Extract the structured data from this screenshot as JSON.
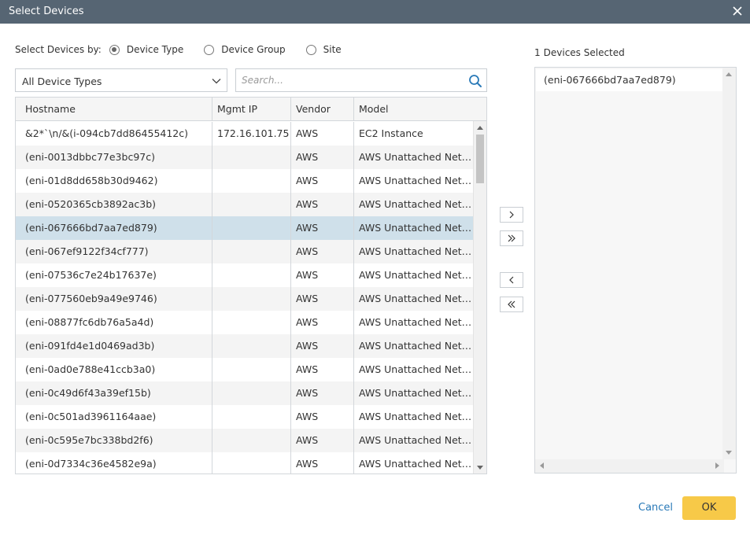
{
  "dialog": {
    "title": "Select Devices"
  },
  "filter": {
    "label": "Select Devices by:",
    "options": [
      {
        "label": "Device Type",
        "checked": true
      },
      {
        "label": "Device Group",
        "checked": false
      },
      {
        "label": "Site",
        "checked": false
      }
    ],
    "select_value": "All Device Types",
    "search_placeholder": "Search..."
  },
  "table": {
    "columns": [
      "Hostname",
      "Mgmt IP",
      "Vendor",
      "Model"
    ],
    "rows": [
      {
        "hostname": "&2*`\\n/&(i-094cb7dd86455412c)",
        "ip": "172.16.101.75",
        "vendor": "AWS",
        "model": "EC2 Instance"
      },
      {
        "hostname": "(eni-0013dbbc77e3bc97c)",
        "ip": "",
        "vendor": "AWS",
        "model": "AWS Unattached Netw..."
      },
      {
        "hostname": "(eni-01d8dd658b30d9462)",
        "ip": "",
        "vendor": "AWS",
        "model": "AWS Unattached Netw..."
      },
      {
        "hostname": "(eni-0520365cb3892ac3b)",
        "ip": "",
        "vendor": "AWS",
        "model": "AWS Unattached Netw..."
      },
      {
        "hostname": "(eni-067666bd7aa7ed879)",
        "ip": "",
        "vendor": "AWS",
        "model": "AWS Unattached Netw...",
        "selected": true
      },
      {
        "hostname": "(eni-067ef9122f34cf777)",
        "ip": "",
        "vendor": "AWS",
        "model": "AWS Unattached Netw..."
      },
      {
        "hostname": "(eni-07536c7e24b17637e)",
        "ip": "",
        "vendor": "AWS",
        "model": "AWS Unattached Netw..."
      },
      {
        "hostname": "(eni-077560eb9a49e9746)",
        "ip": "",
        "vendor": "AWS",
        "model": "AWS Unattached Netw..."
      },
      {
        "hostname": "(eni-08877fc6db76a5a4d)",
        "ip": "",
        "vendor": "AWS",
        "model": "AWS Unattached Netw..."
      },
      {
        "hostname": "(eni-091fd4e1d0469ad3b)",
        "ip": "",
        "vendor": "AWS",
        "model": "AWS Unattached Netw..."
      },
      {
        "hostname": "(eni-0ad0e788e41ccb3a0)",
        "ip": "",
        "vendor": "AWS",
        "model": "AWS Unattached Netw..."
      },
      {
        "hostname": "(eni-0c49d6f43a39ef15b)",
        "ip": "",
        "vendor": "AWS",
        "model": "AWS Unattached Netw..."
      },
      {
        "hostname": "(eni-0c501ad3961164aae)",
        "ip": "",
        "vendor": "AWS",
        "model": "AWS Unattached Netw..."
      },
      {
        "hostname": "(eni-0c595e7bc338bd2f6)",
        "ip": "",
        "vendor": "AWS",
        "model": "AWS Unattached Netw..."
      },
      {
        "hostname": "(eni-0d7334c36e4582e9a)",
        "ip": "",
        "vendor": "AWS",
        "model": "AWS Unattached Netw..."
      }
    ]
  },
  "selected_panel": {
    "count": "1",
    "label": "Devices Selected",
    "items": [
      "(eni-067666bd7aa7ed879)"
    ]
  },
  "transfer_buttons": [
    {
      "name": "move-selected-right",
      "icon": "chevron-right-icon"
    },
    {
      "name": "move-all-right",
      "icon": "double-chevron-right-icon"
    },
    {
      "name": "move-selected-left",
      "icon": "chevron-left-icon"
    },
    {
      "name": "move-all-left",
      "icon": "double-chevron-left-icon"
    }
  ],
  "footer": {
    "cancel_label": "Cancel",
    "ok_label": "OK"
  },
  "colors": {
    "titlebar": "#566573",
    "selected_row": "#cfe0ea",
    "ok_button": "#f7c948",
    "cancel_link": "#2a7ab8"
  }
}
